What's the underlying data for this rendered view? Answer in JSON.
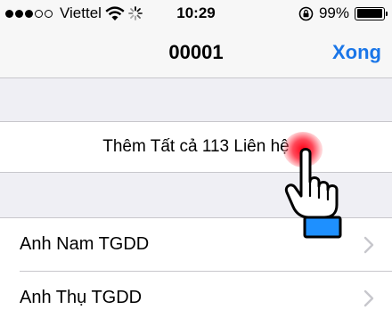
{
  "status_bar": {
    "signal": [
      true,
      true,
      true,
      false,
      false
    ],
    "carrier": "Viettel",
    "time": "10:29",
    "battery_percent": "99%",
    "battery_level": 0.99,
    "icons": [
      "wifi-icon",
      "activity-spinner-icon",
      "rotation-lock-icon",
      "battery-icon"
    ]
  },
  "nav": {
    "title": "00001",
    "done_label": "Xong"
  },
  "add_all": {
    "label": "Thêm Tất cả 113 Liên hệ"
  },
  "contacts": [
    {
      "name": "Anh Nam TGDD"
    },
    {
      "name": "Anh Thụ TGDD"
    }
  ],
  "overlay": {
    "icons": [
      "touch-indicator",
      "pointing-hand-icon"
    ],
    "colors": {
      "touch": "#ff1a2e",
      "cuff": "#1e90ff"
    }
  },
  "colors": {
    "accent": "#1a76e8",
    "background": "#efeff4",
    "separator": "#c8c7cc"
  }
}
